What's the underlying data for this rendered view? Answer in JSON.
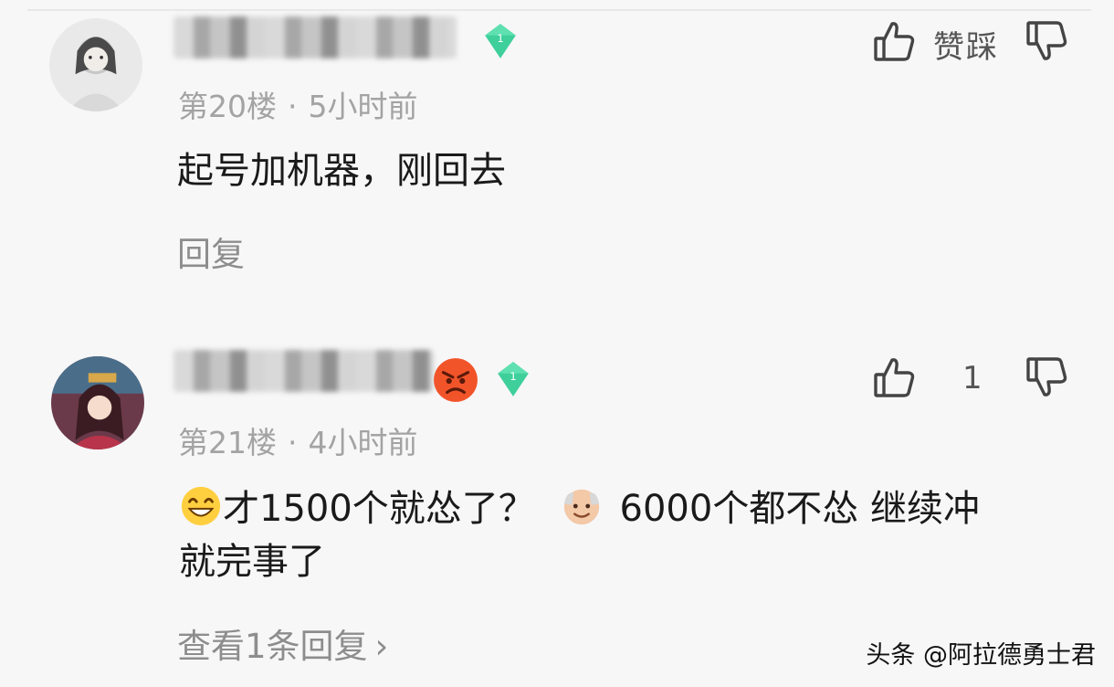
{
  "comments": [
    {
      "floor": "第20楼",
      "time": "5小时前",
      "badge": "1",
      "like_label": "赞",
      "dislike_label": "踩",
      "text": "起号加机器，刚回去",
      "reply_label": "回复"
    },
    {
      "floor": "第21楼",
      "time": "4小时前",
      "badge": "1",
      "like_count": "1",
      "text_part1": "才1500个就怂了？",
      "text_part2": "6000个都不怂 继续冲",
      "text_part3": "就完事了",
      "reply_label": "查看1条回复",
      "reply_chevron": "›"
    }
  ],
  "watermark": "头条 @阿拉德勇士君",
  "colors": {
    "badge_green": "#3fcf9b",
    "meta_gray": "#a3a3a3",
    "background": "#f7f7f8"
  },
  "icons": [
    "thumb-up-icon",
    "thumb-down-icon",
    "diamond-level-badge",
    "angry-face-emoji",
    "grinning-emoji",
    "old-man-emoji"
  ]
}
